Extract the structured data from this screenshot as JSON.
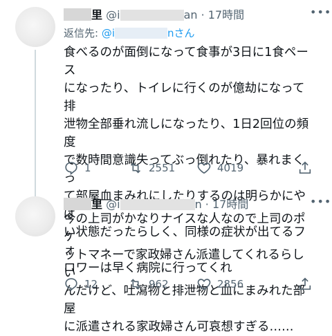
{
  "tweets": [
    {
      "name": "里",
      "handle_prefix": "@i",
      "handle_suffix": "an",
      "time": "17時間",
      "reply_label": "返信先:",
      "reply_prefix": "@i",
      "reply_suffix": "nさん",
      "text": "食べるのが面倒になって食事が3日に1食ペース\nになったり、トイレに行くのが億劫になって排\n泄物全部垂れ流しになったり、1日2回位の頻度\nで数時間意識失ってぶっ倒れたり、暴れまくっ\nて部屋血まみれにしたりするのは明らかにやば\nい状態だったらしく、同様の症状が出てるフォ\nロワーは早く病院に行ってくれ",
      "replies": "1",
      "retweets": "2551",
      "likes": "4019"
    },
    {
      "name": "里",
      "handle_prefix": "@i",
      "handle_suffix": "n",
      "time": "17時間",
      "text": "今の上司がかなりナイスな人なので上司のポケ\nットマネーで家政婦さん派遣してくれるらしい\nんだけど、吐瀉物と排泄物と血にまみれた部屋\nに派遣される家政婦さん可哀想すぎる……",
      "replies": "12",
      "retweets": "962",
      "likes": "2856"
    }
  ],
  "icons": {
    "reply": "reply-icon",
    "retweet": "retweet-icon",
    "like": "heart-icon",
    "share": "share-icon",
    "more": "more-icon"
  },
  "colors": {
    "text": "#0f1419",
    "secondary": "#536471",
    "link": "#1d9bf0",
    "line": "#cfd9de"
  }
}
